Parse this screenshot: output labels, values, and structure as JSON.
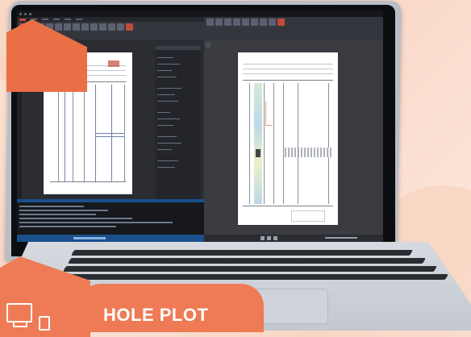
{
  "badge": {
    "label": "HOLE PLOT"
  },
  "app": {
    "left_pane": {
      "tab": "",
      "page_title": ""
    },
    "right_pane": {
      "tab": "",
      "page_title": ""
    }
  },
  "colors": {
    "brand_orange": "#ee7b55",
    "accent_red": "#c24a3a",
    "status_blue": "#1a4f8c"
  },
  "icons": [
    "monitor-icon",
    "device-icon"
  ]
}
